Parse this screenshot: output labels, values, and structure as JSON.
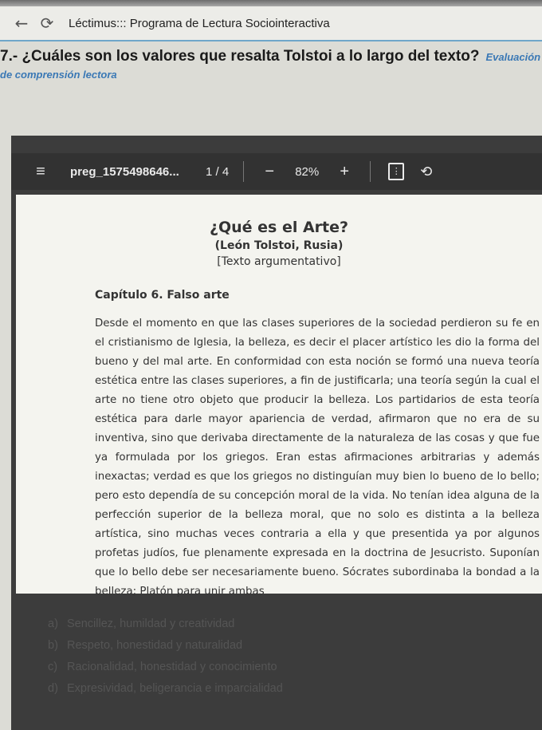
{
  "browser": {
    "back_icon": "back-arrow-icon",
    "reload_icon": "reload-icon",
    "tab_title": "Léctimus::: Programa de Lectura Sociointeractiva"
  },
  "question": {
    "text": "7.- ¿Cuáles son los valores que resalta Tolstoi a lo largo del texto?",
    "tag": "Evaluación de comprensión lectora"
  },
  "viewer": {
    "menu_icon": "menu-icon",
    "doc_name": "preg_1575498646...",
    "page_current": "1",
    "page_sep": "/",
    "page_total": "4",
    "zoom_out": "−",
    "zoom": "82%",
    "zoom_in": "+",
    "fit_icon": "fit-page-icon",
    "rotate_icon": "rotate-icon"
  },
  "document": {
    "title": "¿Qué es el Arte?",
    "author": "(León Tolstoi, Rusia)",
    "type": "[Texto argumentativo]",
    "chapter": "Capítulo 6. Falso arte",
    "body": "Desde el momento en que las clases superiores de la sociedad perdieron su fe en el cristianismo de Iglesia, la belleza, es decir el placer artístico les dio la forma del bueno y del mal arte. En conformidad con esta noción se formó una nueva teoría estética entre las clases superiores, a fin de justificarla; una teoría según la cual el arte no tiene otro objeto que producir la belleza. Los partidarios de esta teoría estética para darle mayor apariencia de verdad, afirmaron que no era de su inventiva, sino que derivaba directamente de la naturaleza de las cosas y que fue ya formulada por los griegos. Eran estas afirmaciones arbitrarias y además inexactas; verdad es que los griegos no distinguían muy bien lo bueno de lo bello; pero esto dependía de su concepción moral de la vida. No tenían idea alguna de la perfección superior de la belleza moral, que no solo es distinta a la belleza artística, sino muchas veces contraria a ella y que presentida ya por algunos profetas judíos, fue plenamente expresada en la doctrina de Jesucristo. Suponían que lo bello debe ser necesariamente bueno. Sócrates subordinaba la bondad a la belleza; Platón para unir ambas"
  },
  "answers": [
    {
      "letter": "a)",
      "text": "Sencillez, humildad y creatividad"
    },
    {
      "letter": "b)",
      "text": "Respeto, honestidad y naturalidad"
    },
    {
      "letter": "c)",
      "text": "Racionalidad, honestidad y conocimiento"
    },
    {
      "letter": "d)",
      "text": "Expresividad, beligerancia e imparcialidad"
    }
  ]
}
